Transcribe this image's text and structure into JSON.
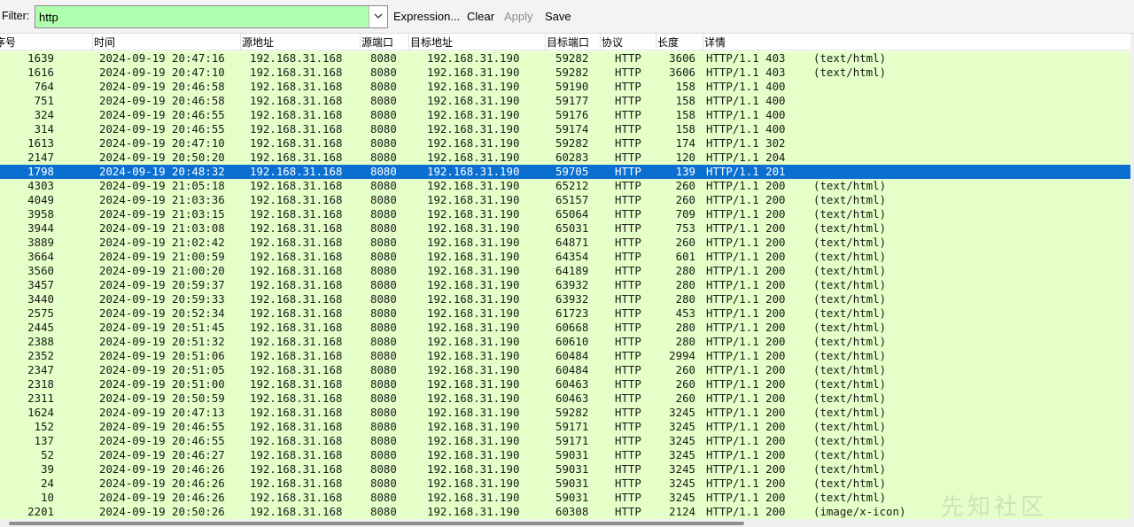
{
  "toolbar": {
    "filter_label": "Filter:",
    "filter_value": "http",
    "expression_label": "Expression...",
    "clear_label": "Clear",
    "apply_label": "Apply",
    "save_label": "Save",
    "filter_bg_color": "#afffaf"
  },
  "columns": [
    "序号",
    "时间",
    "源地址",
    "源端口",
    "目标地址",
    "目标端口",
    "协议",
    "长度",
    "详情"
  ],
  "colors": {
    "row_bg": "#e4ffc7",
    "selected_bg": "#0a6fd0"
  },
  "selected_row": 8,
  "watermark": "先知社区",
  "rows": [
    [
      "1639",
      "2024-09-19 20:47:16",
      "192.168.31.168",
      "8080",
      "192.168.31.190",
      "59282",
      "HTTP",
      "3606",
      "HTTP/1.1 403",
      "(text/html)"
    ],
    [
      "1616",
      "2024-09-19 20:47:10",
      "192.168.31.168",
      "8080",
      "192.168.31.190",
      "59282",
      "HTTP",
      "3606",
      "HTTP/1.1 403",
      "(text/html)"
    ],
    [
      "764",
      "2024-09-19 20:46:58",
      "192.168.31.168",
      "8080",
      "192.168.31.190",
      "59190",
      "HTTP",
      "158",
      "HTTP/1.1 400",
      ""
    ],
    [
      "751",
      "2024-09-19 20:46:58",
      "192.168.31.168",
      "8080",
      "192.168.31.190",
      "59177",
      "HTTP",
      "158",
      "HTTP/1.1 400",
      ""
    ],
    [
      "324",
      "2024-09-19 20:46:55",
      "192.168.31.168",
      "8080",
      "192.168.31.190",
      "59176",
      "HTTP",
      "158",
      "HTTP/1.1 400",
      ""
    ],
    [
      "314",
      "2024-09-19 20:46:55",
      "192.168.31.168",
      "8080",
      "192.168.31.190",
      "59174",
      "HTTP",
      "158",
      "HTTP/1.1 400",
      ""
    ],
    [
      "1613",
      "2024-09-19 20:47:10",
      "192.168.31.168",
      "8080",
      "192.168.31.190",
      "59282",
      "HTTP",
      "174",
      "HTTP/1.1 302",
      ""
    ],
    [
      "2147",
      "2024-09-19 20:50:20",
      "192.168.31.168",
      "8080",
      "192.168.31.190",
      "60283",
      "HTTP",
      "120",
      "HTTP/1.1 204",
      ""
    ],
    [
      "1798",
      "2024-09-19 20:48:32",
      "192.168.31.168",
      "8080",
      "192.168.31.190",
      "59705",
      "HTTP",
      "139",
      "HTTP/1.1 201",
      ""
    ],
    [
      "4303",
      "2024-09-19 21:05:18",
      "192.168.31.168",
      "8080",
      "192.168.31.190",
      "65212",
      "HTTP",
      "260",
      "HTTP/1.1 200",
      "(text/html)"
    ],
    [
      "4049",
      "2024-09-19 21:03:36",
      "192.168.31.168",
      "8080",
      "192.168.31.190",
      "65157",
      "HTTP",
      "260",
      "HTTP/1.1 200",
      "(text/html)"
    ],
    [
      "3958",
      "2024-09-19 21:03:15",
      "192.168.31.168",
      "8080",
      "192.168.31.190",
      "65064",
      "HTTP",
      "709",
      "HTTP/1.1 200",
      "(text/html)"
    ],
    [
      "3944",
      "2024-09-19 21:03:08",
      "192.168.31.168",
      "8080",
      "192.168.31.190",
      "65031",
      "HTTP",
      "753",
      "HTTP/1.1 200",
      "(text/html)"
    ],
    [
      "3889",
      "2024-09-19 21:02:42",
      "192.168.31.168",
      "8080",
      "192.168.31.190",
      "64871",
      "HTTP",
      "260",
      "HTTP/1.1 200",
      "(text/html)"
    ],
    [
      "3664",
      "2024-09-19 21:00:59",
      "192.168.31.168",
      "8080",
      "192.168.31.190",
      "64354",
      "HTTP",
      "601",
      "HTTP/1.1 200",
      "(text/html)"
    ],
    [
      "3560",
      "2024-09-19 21:00:20",
      "192.168.31.168",
      "8080",
      "192.168.31.190",
      "64189",
      "HTTP",
      "280",
      "HTTP/1.1 200",
      "(text/html)"
    ],
    [
      "3457",
      "2024-09-19 20:59:37",
      "192.168.31.168",
      "8080",
      "192.168.31.190",
      "63932",
      "HTTP",
      "280",
      "HTTP/1.1 200",
      "(text/html)"
    ],
    [
      "3440",
      "2024-09-19 20:59:33",
      "192.168.31.168",
      "8080",
      "192.168.31.190",
      "63932",
      "HTTP",
      "280",
      "HTTP/1.1 200",
      "(text/html)"
    ],
    [
      "2575",
      "2024-09-19 20:52:34",
      "192.168.31.168",
      "8080",
      "192.168.31.190",
      "61723",
      "HTTP",
      "453",
      "HTTP/1.1 200",
      "(text/html)"
    ],
    [
      "2445",
      "2024-09-19 20:51:45",
      "192.168.31.168",
      "8080",
      "192.168.31.190",
      "60668",
      "HTTP",
      "280",
      "HTTP/1.1 200",
      "(text/html)"
    ],
    [
      "2388",
      "2024-09-19 20:51:32",
      "192.168.31.168",
      "8080",
      "192.168.31.190",
      "60610",
      "HTTP",
      "280",
      "HTTP/1.1 200",
      "(text/html)"
    ],
    [
      "2352",
      "2024-09-19 20:51:06",
      "192.168.31.168",
      "8080",
      "192.168.31.190",
      "60484",
      "HTTP",
      "2994",
      "HTTP/1.1 200",
      "(text/html)"
    ],
    [
      "2347",
      "2024-09-19 20:51:05",
      "192.168.31.168",
      "8080",
      "192.168.31.190",
      "60484",
      "HTTP",
      "260",
      "HTTP/1.1 200",
      "(text/html)"
    ],
    [
      "2318",
      "2024-09-19 20:51:00",
      "192.168.31.168",
      "8080",
      "192.168.31.190",
      "60463",
      "HTTP",
      "260",
      "HTTP/1.1 200",
      "(text/html)"
    ],
    [
      "2311",
      "2024-09-19 20:50:59",
      "192.168.31.168",
      "8080",
      "192.168.31.190",
      "60463",
      "HTTP",
      "260",
      "HTTP/1.1 200",
      "(text/html)"
    ],
    [
      "1624",
      "2024-09-19 20:47:13",
      "192.168.31.168",
      "8080",
      "192.168.31.190",
      "59282",
      "HTTP",
      "3245",
      "HTTP/1.1 200",
      "(text/html)"
    ],
    [
      "152",
      "2024-09-19 20:46:55",
      "192.168.31.168",
      "8080",
      "192.168.31.190",
      "59171",
      "HTTP",
      "3245",
      "HTTP/1.1 200",
      "(text/html)"
    ],
    [
      "137",
      "2024-09-19 20:46:55",
      "192.168.31.168",
      "8080",
      "192.168.31.190",
      "59171",
      "HTTP",
      "3245",
      "HTTP/1.1 200",
      "(text/html)"
    ],
    [
      "52",
      "2024-09-19 20:46:27",
      "192.168.31.168",
      "8080",
      "192.168.31.190",
      "59031",
      "HTTP",
      "3245",
      "HTTP/1.1 200",
      "(text/html)"
    ],
    [
      "39",
      "2024-09-19 20:46:26",
      "192.168.31.168",
      "8080",
      "192.168.31.190",
      "59031",
      "HTTP",
      "3245",
      "HTTP/1.1 200",
      "(text/html)"
    ],
    [
      "24",
      "2024-09-19 20:46:26",
      "192.168.31.168",
      "8080",
      "192.168.31.190",
      "59031",
      "HTTP",
      "3245",
      "HTTP/1.1 200",
      "(text/html)"
    ],
    [
      "10",
      "2024-09-19 20:46:26",
      "192.168.31.168",
      "8080",
      "192.168.31.190",
      "59031",
      "HTTP",
      "3245",
      "HTTP/1.1 200",
      "(text/html)"
    ],
    [
      "2201",
      "2024-09-19 20:50:26",
      "192.168.31.168",
      "8080",
      "192.168.31.190",
      "60308",
      "HTTP",
      "2124",
      "HTTP/1.1 200",
      "(image/x-icon)"
    ]
  ]
}
